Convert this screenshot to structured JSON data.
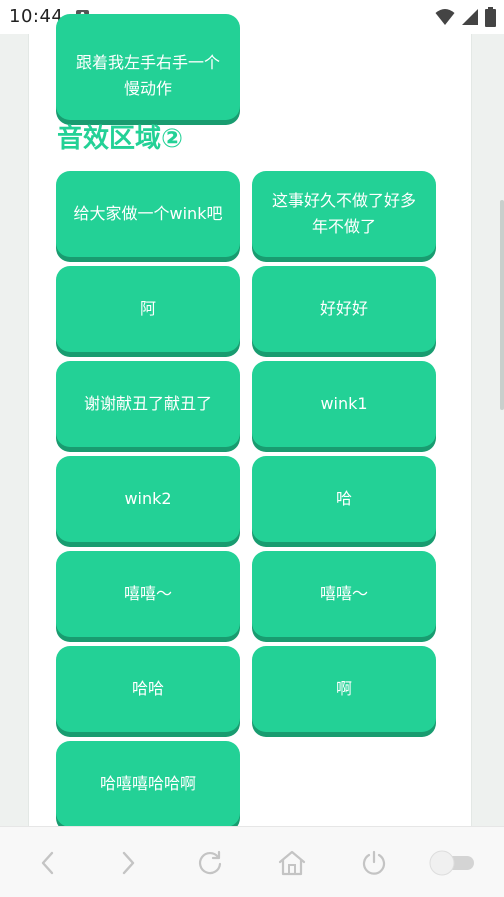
{
  "status": {
    "time": "10:44",
    "notification_badge": "A"
  },
  "partial_button": {
    "label": "跟着我左手右手一个慢动作"
  },
  "section": {
    "title": "音效区域②"
  },
  "sounds": [
    "给大家做一个wink吧",
    "这事好久不做了好多年不做了",
    "阿",
    "好好好",
    "谢谢献丑了献丑了",
    "wink1",
    "wink2",
    "哈",
    "嘻嘻～",
    "嘻嘻～",
    "哈哈",
    "啊",
    "哈嘻嘻哈哈啊"
  ],
  "nav": {
    "back_icon": "chevron-left-icon",
    "forward_icon": "chevron-right-icon",
    "refresh_icon": "refresh-icon",
    "home_icon": "home-icon",
    "power_icon": "power-icon",
    "toggle_icon": "toggle-switch-icon"
  },
  "colors": {
    "accent": "#23d196",
    "accent_shadow": "#199c70"
  }
}
